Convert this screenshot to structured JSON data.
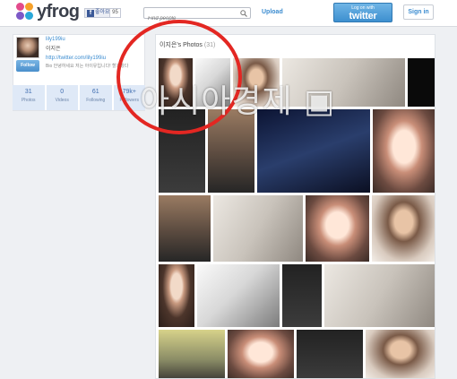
{
  "header": {
    "logo": "yfrog",
    "fb_like_label": "좋아요",
    "fb_like_count": "95",
    "search_placeholder": "Find people",
    "upload_label": "Upload",
    "twitter_small": "Log on with",
    "twitter_big": "twitter",
    "signin_label": "Sign in"
  },
  "profile": {
    "username": "lily199iu",
    "display_name": "이지은",
    "url": "http://twitter.com/lily199iu",
    "bio": "Bio 안녕하세요 저는 아이유입니다! 할거봤다",
    "follow_label": "Follow"
  },
  "stats": [
    {
      "value": "31",
      "label": "Photos"
    },
    {
      "value": "0",
      "label": "Videos"
    },
    {
      "value": "61",
      "label": "Following"
    },
    {
      "value": "79k+",
      "label": "Followers"
    }
  ],
  "photos_panel": {
    "title": "이지은's Photos",
    "count": "(31)"
  },
  "watermark": "아시아경제 ▣",
  "colors": {
    "link_blue": "#3b8cd0",
    "highlight_circle": "#e32722",
    "stat_bg": "#dfe9f7"
  }
}
